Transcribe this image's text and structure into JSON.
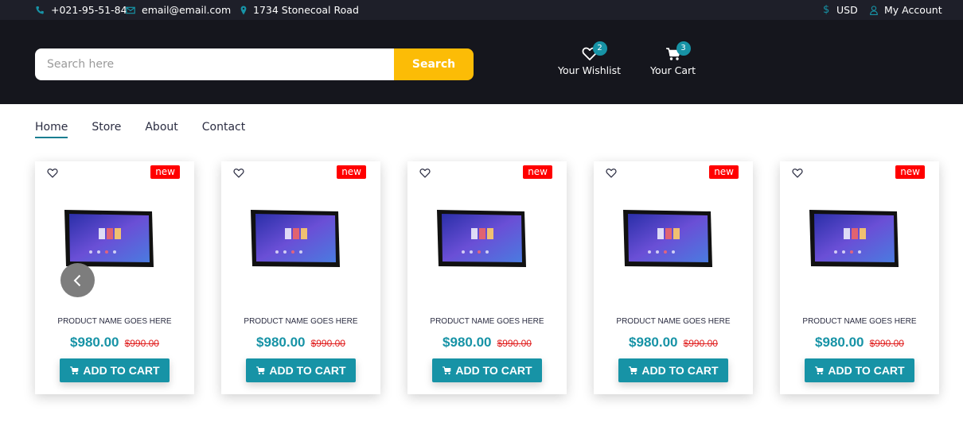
{
  "topbar": {
    "phone": "+021-95-51-84",
    "email": "email@email.com",
    "address": "1734 Stonecoal Road",
    "currency": "USD",
    "account": "My Account"
  },
  "search": {
    "placeholder": "Search here",
    "button": "Search"
  },
  "header": {
    "wishlist_label": "Your Wishlist",
    "wishlist_count": "2",
    "cart_label": "Your Cart",
    "cart_count": "3"
  },
  "nav": {
    "items": [
      "Home",
      "Store",
      "About",
      "Contact"
    ],
    "active": "Home"
  },
  "products": [
    {
      "badge": "new",
      "name": "PRODUCT NAME GOES HERE",
      "price": "$980.00",
      "old_price": "$990.00",
      "button": "ADD TO CART"
    },
    {
      "badge": "new",
      "name": "PRODUCT NAME GOES HERE",
      "price": "$980.00",
      "old_price": "$990.00",
      "button": "ADD TO CART"
    },
    {
      "badge": "new",
      "name": "PRODUCT NAME GOES HERE",
      "price": "$980.00",
      "old_price": "$990.00",
      "button": "ADD TO CART"
    },
    {
      "badge": "new",
      "name": "PRODUCT NAME GOES HERE",
      "price": "$980.00",
      "old_price": "$990.00",
      "button": "ADD TO CART"
    },
    {
      "badge": "new",
      "name": "PRODUCT NAME GOES HERE",
      "price": "$980.00",
      "old_price": "$990.00",
      "button": "ADD TO CART"
    }
  ],
  "colors": {
    "topbar_bg": "#1e1f29",
    "header_bg": "#15161d",
    "accent": "#1793a6",
    "search_button": "#fcbc06",
    "new_badge": "#ff0000",
    "old_price": "#e02020"
  },
  "icons": {
    "phone": "phone-icon",
    "email": "envelope-icon",
    "address": "map-marker-icon",
    "currency": "dollar-icon",
    "account": "user-icon",
    "wishlist": "heart-icon",
    "cart": "shopping-cart-icon",
    "prev": "chevron-left-icon"
  }
}
